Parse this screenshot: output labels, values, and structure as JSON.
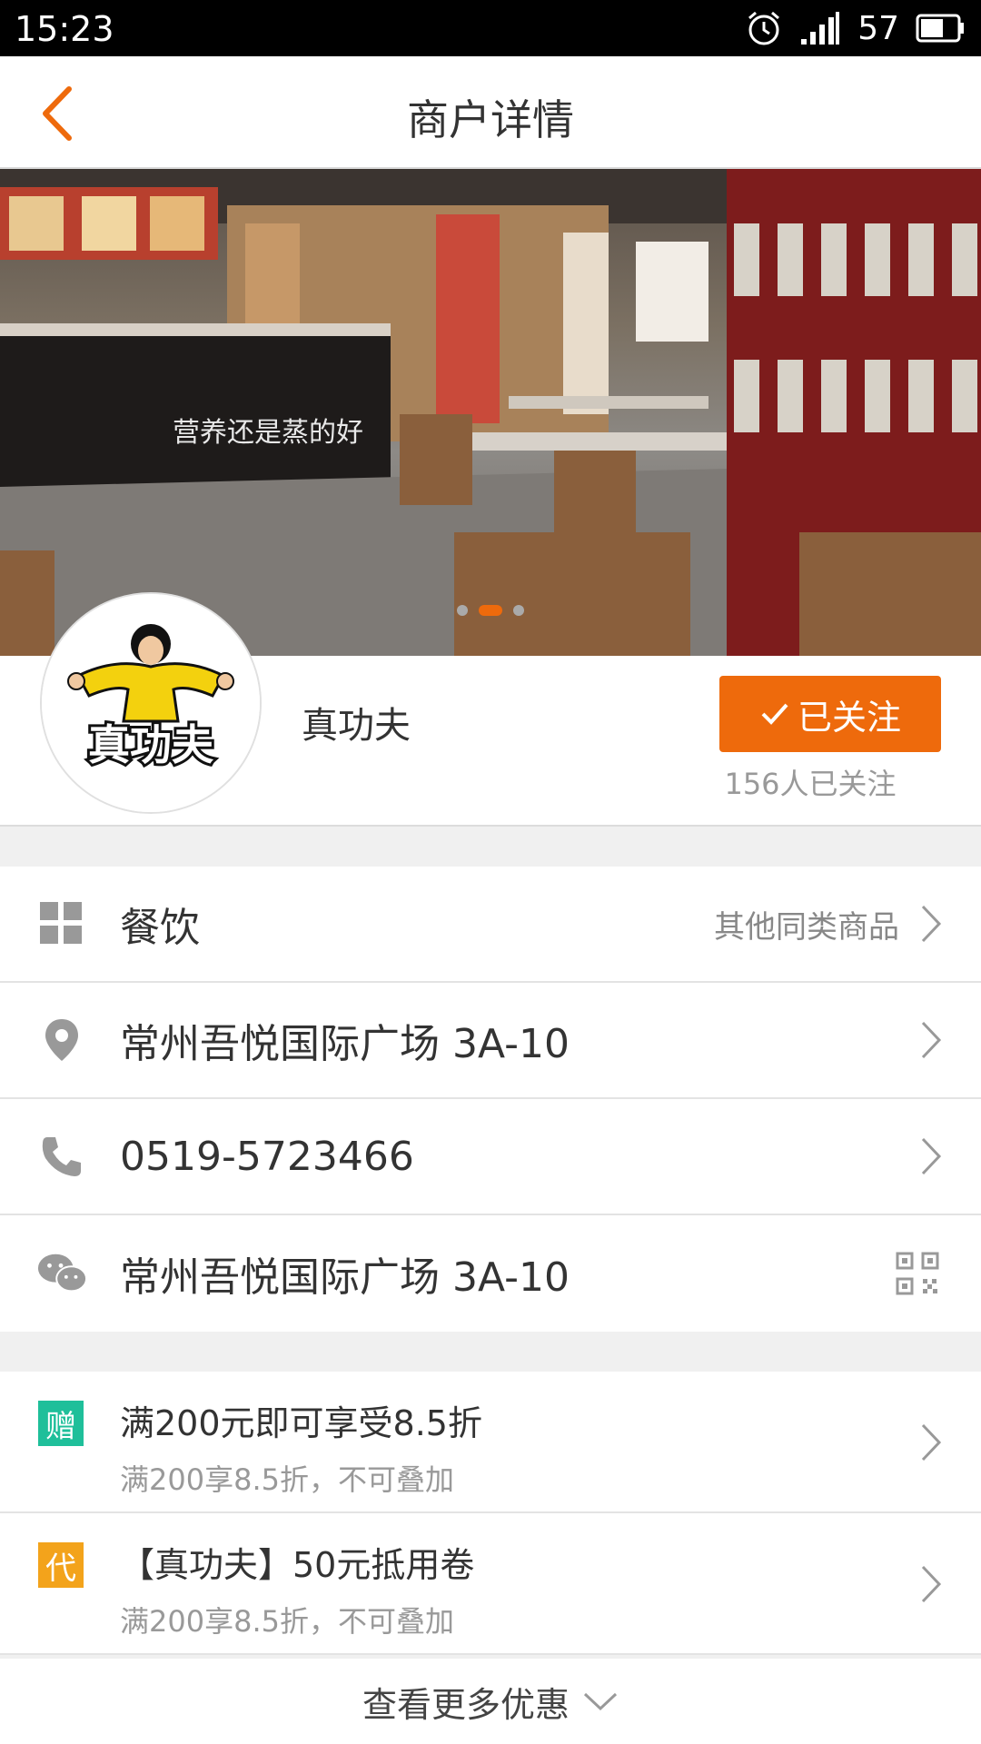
{
  "status_bar": {
    "time": "15:23",
    "battery": "57"
  },
  "nav": {
    "title": "商户详情"
  },
  "carousel": {
    "active_index": 1,
    "count": 3
  },
  "shop": {
    "name": "真功夫",
    "logo_text": "真功夫",
    "follow_label": "已关注",
    "follow_count": "156人已关注"
  },
  "info_rows": [
    {
      "text": "餐饮",
      "side": "其他同类商品"
    },
    {
      "text": "常州吾悦国际广场 3A-10"
    },
    {
      "text": "0519-5723466"
    },
    {
      "text": "常州吾悦国际广场 3A-10"
    }
  ],
  "promos": [
    {
      "tag": "赠",
      "tag_color": "#1fbf9a",
      "title": "满200元即可享受8.5折",
      "desc": "满200享8.5折，不可叠加"
    },
    {
      "tag": "代",
      "tag_color": "#f3a31b",
      "title": "【真功夫】50元抵用卷",
      "desc": "满200享8.5折，不可叠加"
    }
  ],
  "more_label": "查看更多优惠",
  "colors": {
    "accent": "#ee6a0c",
    "gift": "#1fbf9a",
    "voucher": "#f3a31b"
  }
}
